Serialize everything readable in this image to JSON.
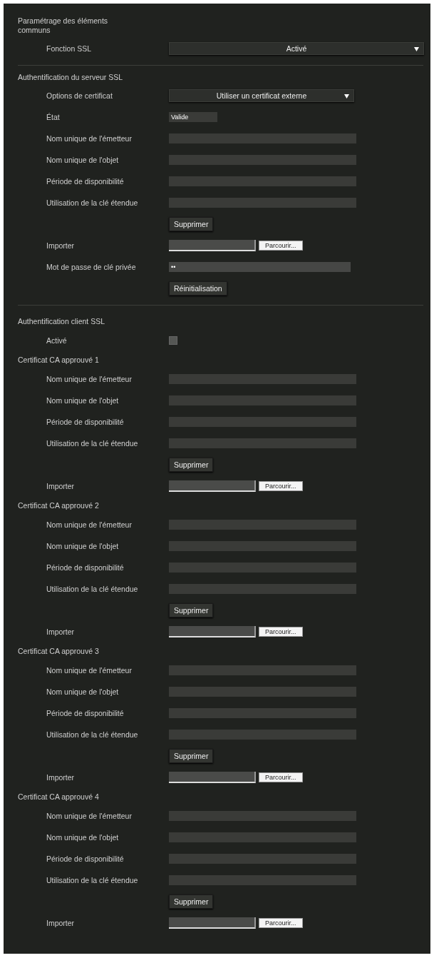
{
  "common": {
    "title": "Paramétrage des éléments communs",
    "ssl_function": {
      "label": "Fonction SSL",
      "value": "Activé"
    }
  },
  "server_auth": {
    "title": "Authentification du serveur SSL",
    "certificate_options": {
      "label": "Options de certificat",
      "value": "Utiliser un certificat externe"
    },
    "status": {
      "label": "État",
      "value": "Valide"
    },
    "fields": [
      {
        "label": "Nom unique de l'émetteur"
      },
      {
        "label": "Nom unique de l'objet"
      },
      {
        "label": "Période de disponibilité"
      },
      {
        "label": "Utilisation de la clé étendue"
      }
    ],
    "delete_button": "Supprimer",
    "import": {
      "label": "Importer",
      "browse_button": "Parcourir..."
    },
    "private_key_password": {
      "label": "Mot de passe de clé privée",
      "value": "••"
    },
    "reset_button": "Réinitialisation"
  },
  "client_auth": {
    "title": "Authentification client SSL",
    "enabled": {
      "label": "Activé",
      "checked": false
    },
    "ca_certificates": [
      {
        "title": "Certificat CA approuvé 1",
        "fields": [
          {
            "label": "Nom unique de l'émetteur"
          },
          {
            "label": "Nom unique de l'objet"
          },
          {
            "label": "Période de disponibilité"
          },
          {
            "label": "Utilisation de la clé étendue"
          }
        ],
        "delete_button": "Supprimer",
        "import": {
          "label": "Importer",
          "browse_button": "Parcourir..."
        }
      },
      {
        "title": "Certificat CA approuvé 2",
        "fields": [
          {
            "label": "Nom unique de l'émetteur"
          },
          {
            "label": "Nom unique de l'objet"
          },
          {
            "label": "Période de disponibilité"
          },
          {
            "label": "Utilisation de la clé étendue"
          }
        ],
        "delete_button": "Supprimer",
        "import": {
          "label": "Importer",
          "browse_button": "Parcourir..."
        }
      },
      {
        "title": "Certificat CA approuvé 3",
        "fields": [
          {
            "label": "Nom unique de l'émetteur"
          },
          {
            "label": "Nom unique de l'objet"
          },
          {
            "label": "Période de disponibilité"
          },
          {
            "label": "Utilisation de la clé étendue"
          }
        ],
        "delete_button": "Supprimer",
        "import": {
          "label": "Importer",
          "browse_button": "Parcourir..."
        }
      },
      {
        "title": "Certificat CA approuvé 4",
        "fields": [
          {
            "label": "Nom unique de l'émetteur"
          },
          {
            "label": "Nom unique de l'objet"
          },
          {
            "label": "Période de disponibilité"
          },
          {
            "label": "Utilisation de la clé étendue"
          }
        ],
        "delete_button": "Supprimer",
        "import": {
          "label": "Importer",
          "browse_button": "Parcourir..."
        }
      }
    ]
  }
}
